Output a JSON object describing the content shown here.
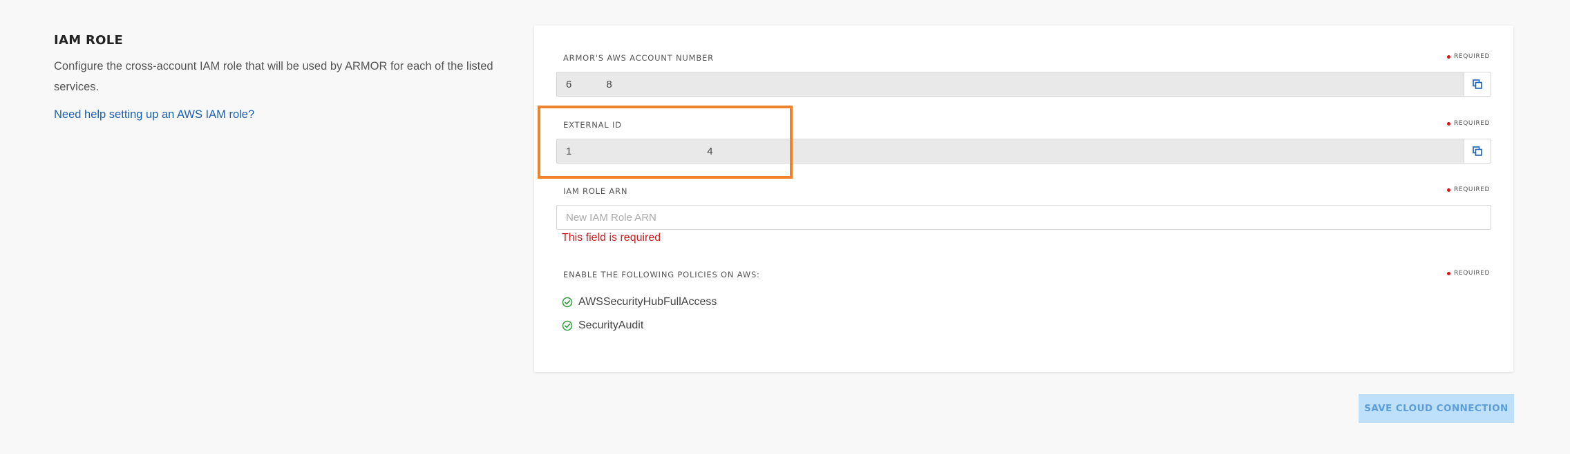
{
  "section": {
    "title": "IAM ROLE",
    "description": "Configure the cross-account IAM role that will be used by ARMOR for each of the listed services.",
    "help_link": "Need help setting up an AWS IAM role?"
  },
  "form": {
    "required_label": "REQUIRED",
    "account_number": {
      "label": "ARMOR'S AWS ACCOUNT NUMBER",
      "value": "6            8"
    },
    "external_id": {
      "label": "EXTERNAL ID",
      "value": "1                                               4"
    },
    "iam_role_arn": {
      "label": "IAM ROLE ARN",
      "placeholder": "New IAM Role ARN",
      "value": "",
      "error": "This field is required"
    },
    "policies": {
      "label": "ENABLE THE FOLLOWING POLICIES ON AWS:",
      "items": [
        "AWSSecurityHubFullAccess",
        "SecurityAudit"
      ]
    }
  },
  "actions": {
    "save_label": "SAVE CLOUD CONNECTION"
  },
  "colors": {
    "highlight": "#f0822b",
    "error": "#cc1f1f",
    "link": "#1a5fb4",
    "check": "#2e9b3a",
    "save_button_bg": "#bfe0fb"
  },
  "icons": {
    "copy": "copy-icon",
    "check": "check-circle-icon",
    "required": "required-dot-icon"
  }
}
